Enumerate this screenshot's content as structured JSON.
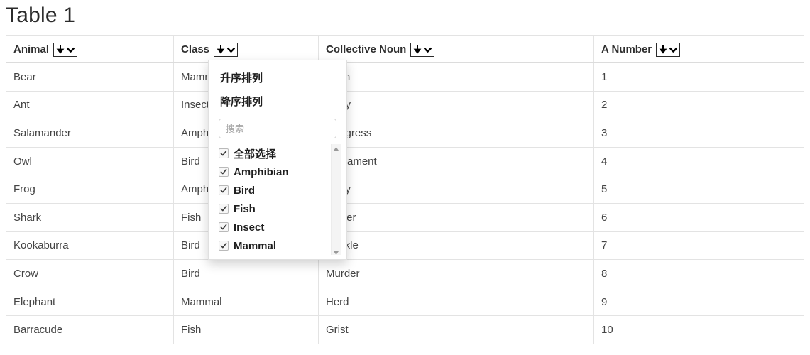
{
  "page": {
    "title": "Table 1"
  },
  "table": {
    "columns": [
      {
        "label": "Animal",
        "sort_icon": "sort-filter-icon"
      },
      {
        "label": "Class",
        "sort_icon": "sort-filter-icon"
      },
      {
        "label": "Collective Noun",
        "sort_icon": "sort-filter-icon"
      },
      {
        "label": "A Number",
        "sort_icon": "sort-filter-icon"
      }
    ],
    "rows": [
      {
        "animal": "Bear",
        "class": "Mammal",
        "noun": "Sloth",
        "number": "1"
      },
      {
        "animal": "Ant",
        "class": "Insect",
        "noun": "Army",
        "number": "2"
      },
      {
        "animal": "Salamander",
        "class": "Amphibian",
        "noun": "Congress",
        "number": "3"
      },
      {
        "animal": "Owl",
        "class": "Bird",
        "noun": "Parliament",
        "number": "4"
      },
      {
        "animal": "Frog",
        "class": "Amphibian",
        "noun": "Army",
        "number": "5"
      },
      {
        "animal": "Shark",
        "class": "Fish",
        "noun": "Shiver",
        "number": "6"
      },
      {
        "animal": "Kookaburra",
        "class": "Bird",
        "noun": "Cackle",
        "number": "7"
      },
      {
        "animal": "Crow",
        "class": "Bird",
        "noun": "Murder",
        "number": "8"
      },
      {
        "animal": "Elephant",
        "class": "Mammal",
        "noun": "Herd",
        "number": "9"
      },
      {
        "animal": "Barracude",
        "class": "Fish",
        "noun": "Grist",
        "number": "10"
      }
    ]
  },
  "filter_panel": {
    "open_for_column": "Class",
    "sort_ascending_label": "升序排列",
    "sort_descending_label": "降序排列",
    "search_placeholder": "搜索",
    "search_value": "",
    "options": [
      {
        "label": "全部选择",
        "checked": true
      },
      {
        "label": "Amphibian",
        "checked": true
      },
      {
        "label": "Bird",
        "checked": true
      },
      {
        "label": "Fish",
        "checked": true
      },
      {
        "label": "Insect",
        "checked": true
      },
      {
        "label": "Mammal",
        "checked": true
      }
    ],
    "scroll_up_icon": "triangle-up-icon",
    "scroll_down_icon": "triangle-down-icon"
  },
  "colors": {
    "text": "#333333",
    "border": "#e3e3e3",
    "panel_border": "#e0e0e0",
    "placeholder": "#a6a6a6"
  }
}
